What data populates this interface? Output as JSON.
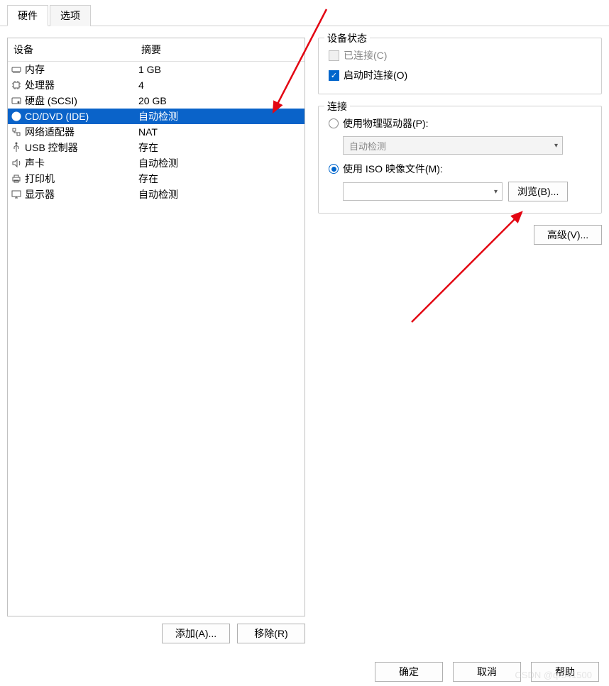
{
  "tabs": {
    "hardware": "硬件",
    "options": "选项"
  },
  "hw_header": {
    "device": "设备",
    "summary": "摘要"
  },
  "hw": [
    {
      "icon": "memory-icon",
      "name": "内存",
      "summary": "1 GB"
    },
    {
      "icon": "cpu-icon",
      "name": "处理器",
      "summary": "4"
    },
    {
      "icon": "disk-icon",
      "name": "硬盘 (SCSI)",
      "summary": "20 GB"
    },
    {
      "icon": "disc-icon",
      "name": "CD/DVD (IDE)",
      "summary": "自动检测"
    },
    {
      "icon": "network-icon",
      "name": "网络适配器",
      "summary": "NAT"
    },
    {
      "icon": "usb-icon",
      "name": "USB 控制器",
      "summary": "存在"
    },
    {
      "icon": "sound-icon",
      "name": "声卡",
      "summary": "自动检测"
    },
    {
      "icon": "printer-icon",
      "name": "打印机",
      "summary": "存在"
    },
    {
      "icon": "display-icon",
      "name": "显示器",
      "summary": "自动检测"
    }
  ],
  "buttons": {
    "add": "添加(A)...",
    "remove": "移除(R)",
    "browse": "浏览(B)...",
    "advanced": "高级(V)...",
    "ok": "确定",
    "cancel": "取消",
    "help": "帮助"
  },
  "device_state": {
    "title": "设备状态",
    "connected": "已连接(C)",
    "connect_on_poweron": "启动时连接(O)"
  },
  "connection": {
    "title": "连接",
    "physical": "使用物理驱动器(P):",
    "physical_value": "自动检测",
    "iso": "使用 ISO 映像文件(M):",
    "iso_value": ""
  },
  "watermark": "CSDN @qr541500"
}
